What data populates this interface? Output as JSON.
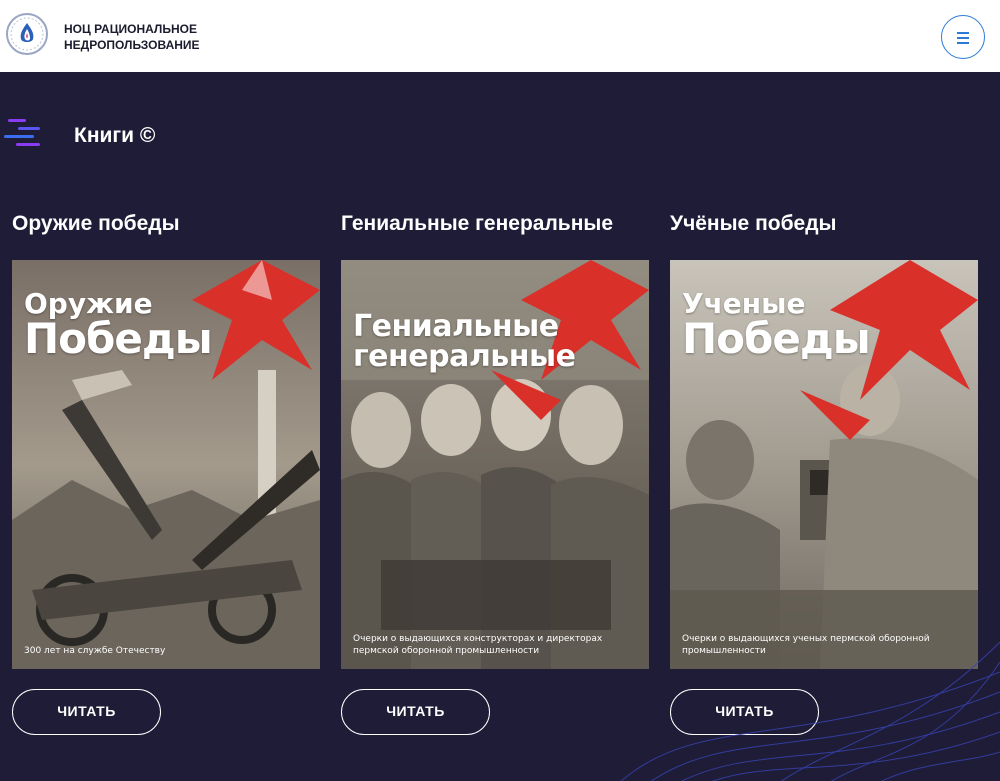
{
  "header": {
    "org_name_line1": "НОЦ РАЦИОНАЛЬНОЕ",
    "org_name_line2": "НЕДРОПОЛЬЗОВАНИЕ",
    "logo_icon": "drop-emblem-icon",
    "menu_icon": "hamburger-icon"
  },
  "section": {
    "title": "Книги ©",
    "icon": "lines-icon"
  },
  "books": [
    {
      "title": "Оружие победы",
      "cover_line1": "Оружие",
      "cover_line2": "Победы",
      "cover_subtitle": "300 лет на службе  Отечеству",
      "button": "ЧИТАТЬ"
    },
    {
      "title": "Гениальные генеральные",
      "cover_line1": "Гениальные",
      "cover_line2": "генеральные",
      "cover_subtitle": "Очерки о выдающихся конструкторах и директорах пермской оборонной промышленности",
      "button": "ЧИТАТЬ"
    },
    {
      "title": "Учёные победы",
      "cover_line1": "Ученые",
      "cover_line2": "Победы",
      "cover_subtitle": "Очерки о выдающихся ученых пермской оборонной промышленности",
      "button": "ЧИТАТЬ"
    }
  ],
  "colors": {
    "background": "#1e1c36",
    "header_bg": "#ffffff",
    "accent_blue": "#2b7ad6",
    "star_red": "#d9302a",
    "icon_purple": "#8a3df0",
    "icon_blue": "#3b6df0"
  }
}
